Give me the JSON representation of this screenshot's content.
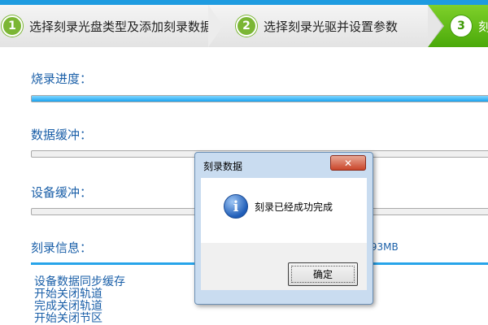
{
  "wizard": {
    "steps": [
      {
        "number": "1",
        "label": "选择刻录光盘类型及添加刻录数据"
      },
      {
        "number": "2",
        "label": "选择刻录光驱并设置参数"
      },
      {
        "number": "3",
        "label": "刻"
      }
    ]
  },
  "progress": {
    "burn_label": "烧录进度：",
    "burn_fraction": 1.0,
    "buffer_label": "数据缓冲：",
    "buffer_fraction": 0.0,
    "device_label": "设备缓冲：",
    "device_fraction": 0.0
  },
  "info": {
    "label": "刻录信息：",
    "size_text": ".93MB",
    "log": [
      "设备数据同步缓存",
      "开始关闭轨道",
      "完成关闭轨道",
      "开始关闭节区"
    ]
  },
  "dialog": {
    "title": "刻录数据",
    "close_glyph": "✕",
    "icon": "info-icon",
    "icon_glyph": "i",
    "message": "刻录已经成功完成",
    "ok_label": "确定"
  },
  "colors": {
    "accent": "#1e9be0",
    "active_step": "#4aa90a",
    "label_text": "#1a5fa8"
  }
}
